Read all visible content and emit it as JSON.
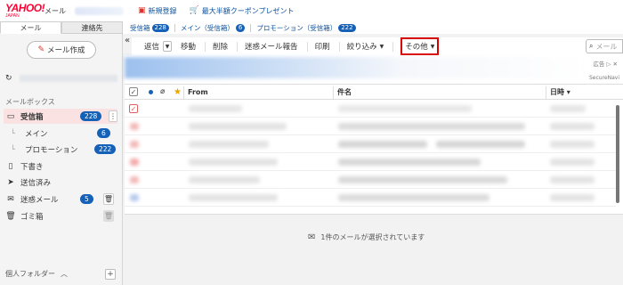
{
  "header": {
    "logo_main": "YAHOO!",
    "logo_sub": "JAPAN",
    "app_name": "メール",
    "links": [
      {
        "label": "新規登録",
        "icon": "folder-plus-icon"
      },
      {
        "label": "最大半額クーポンプレゼント",
        "icon": "shopping-cart-icon"
      }
    ]
  },
  "tabs": {
    "left": [
      "メール",
      "連絡先"
    ],
    "folders": [
      {
        "label": "受信箱",
        "count": "228"
      },
      {
        "label": "メイン（受信箱）",
        "count": "6"
      },
      {
        "label": "プロモーション（受信箱）",
        "count": "222"
      }
    ]
  },
  "sidebar": {
    "compose_label": "メール作成",
    "mailbox_heading": "メールボックス",
    "items": [
      {
        "label": "受信箱",
        "count": "228",
        "icon": "inbox-icon"
      },
      {
        "label": "メイン",
        "count": "6",
        "icon": ""
      },
      {
        "label": "プロモーション",
        "count": "222",
        "icon": ""
      },
      {
        "label": "下書き",
        "count": "",
        "icon": "draft-icon"
      },
      {
        "label": "送信済み",
        "count": "",
        "icon": "send-icon"
      },
      {
        "label": "迷惑メール",
        "count": "5",
        "icon": "spam-icon"
      },
      {
        "label": "ゴミ箱",
        "count": "",
        "icon": "trash-icon"
      }
    ],
    "personal_folders": "個人フォルダー"
  },
  "toolbar": {
    "buttons": [
      "返信",
      "移動",
      "削除",
      "迷惑メール報告",
      "印刷",
      "絞り込み",
      "その他"
    ],
    "search_placeholder": "メール"
  },
  "ad": {
    "tag": "広告",
    "sub": "SecureNavi"
  },
  "list": {
    "columns": {
      "from": "From",
      "subject": "件名",
      "date": "日時"
    }
  },
  "status": {
    "message": "1件のメールが選択されています"
  },
  "colors": {
    "accent": "#1561b8",
    "brand": "#ff0033",
    "highlight": "#d60000"
  }
}
